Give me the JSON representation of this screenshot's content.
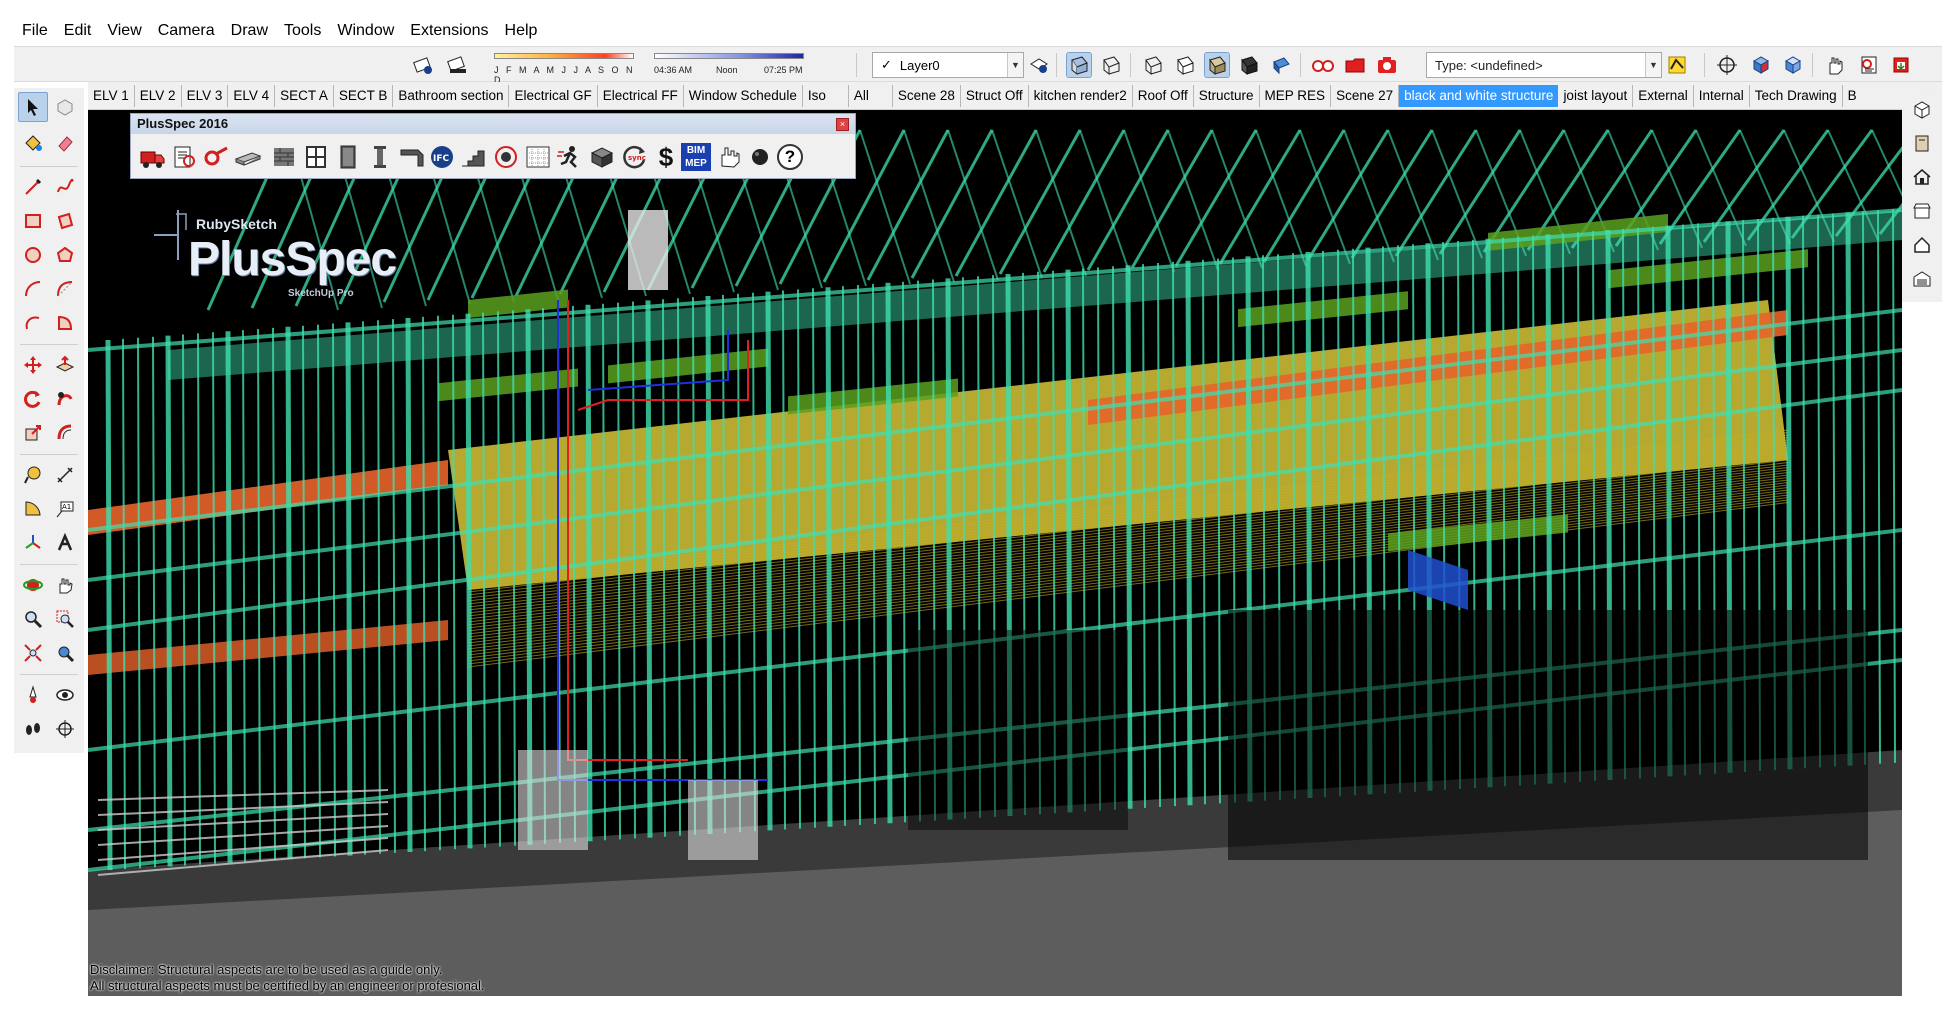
{
  "menu": [
    "File",
    "Edit",
    "View",
    "Camera",
    "Draw",
    "Tools",
    "Window",
    "Extensions",
    "Help"
  ],
  "shadows": {
    "months": "J F M A M J J A S O N D",
    "time_start": "04:36 AM",
    "time_noon": "Noon",
    "time_end": "07:25 PM"
  },
  "layer": {
    "check": "✓",
    "value": "Layer0"
  },
  "type_field": {
    "value": "Type: <undefined>"
  },
  "scene_tabs": [
    "ELV 1",
    "ELV 2",
    "ELV 3",
    "ELV 4",
    "SECT A",
    "SECT B",
    "Bathroom section",
    "Electrical GF",
    "Electrical FF",
    "Window Schedule",
    "Iso",
    "All",
    "Scene 28",
    "Struct Off",
    "kitchen render2",
    "Roof Off",
    "Structure",
    "MEP RES",
    "Scene 27",
    "black and white structure",
    "joist layout",
    "External",
    "Internal",
    "Tech Drawing",
    "B"
  ],
  "active_tab": "black and white structure",
  "plusspec": {
    "title": "PlusSpec 2016",
    "close": "×",
    "ifc_label": "IFC",
    "sync_label": "sync",
    "dollar_label": "$",
    "bim_label": "BIM",
    "mep_label": "MEP",
    "help_label": "?"
  },
  "logo": {
    "brand_small": "RubySketch",
    "brand_large": "PlusSpec",
    "sub": "SketchUp Pro"
  },
  "disclaimer": {
    "line1": "Disclaimer: Structural aspects are to be used as a guide only.",
    "line2": "All structural aspects must be certified by an engineer or profesional."
  },
  "colors": {
    "frame": "#3fe0b0",
    "beam_orange": "#e8642a",
    "beam_yellow": "#f4e040",
    "beam_green": "#5aa020",
    "glass_blue": "#2050d0",
    "pipe_red": "#e02020",
    "pipe_blue": "#2030e0",
    "active_tab": "#3399ff"
  }
}
